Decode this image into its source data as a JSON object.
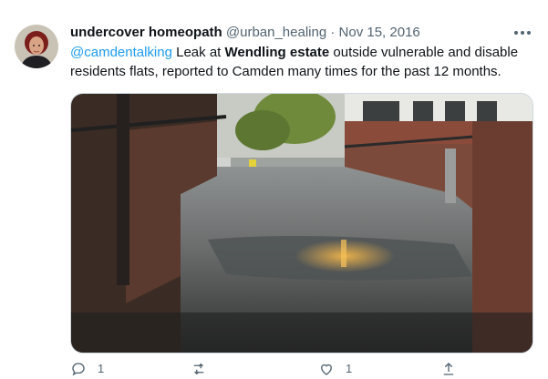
{
  "tweet": {
    "author_name": "undercover homeopath",
    "handle": "@urban_healing",
    "separator": "·",
    "date": "Nov 15, 2016",
    "text": {
      "mention": "@camdentalking",
      "part1": " Leak at ",
      "bold": "Wendling estate",
      "part2": " outside vulnerable and disable residents flats, reported to Camden many times for the past 12 months."
    },
    "media_icon": "photo-walkway-puddle",
    "actions": {
      "reply_count": "1",
      "retweet_count": "",
      "like_count": "1"
    }
  },
  "icons": {
    "more": "more-icon",
    "reply": "reply-icon",
    "retweet": "retweet-icon",
    "like": "like-icon",
    "share": "share-icon"
  },
  "colors": {
    "accent": "#1d9bf0",
    "text": "#0f1419",
    "secondary": "#536471"
  }
}
